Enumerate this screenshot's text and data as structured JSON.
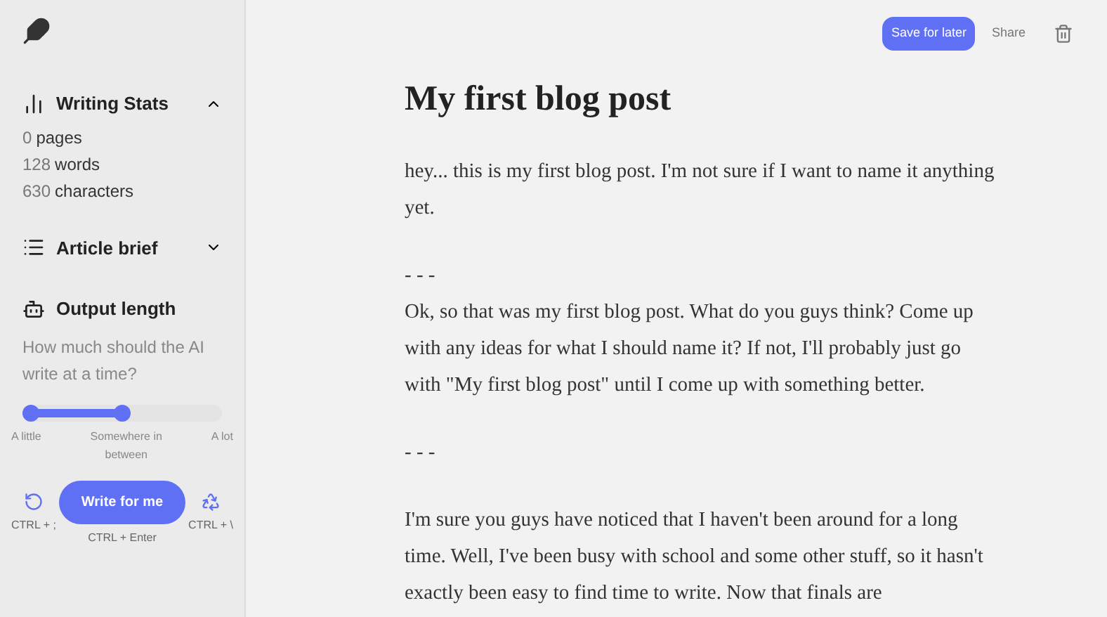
{
  "sidebar": {
    "sections": [
      {
        "kind": "stats",
        "title": "Writing Stats",
        "expanded": true,
        "stats": [
          {
            "count": "0",
            "unit": "pages"
          },
          {
            "count": "128",
            "unit": "words"
          },
          {
            "count": "630",
            "unit": "characters"
          }
        ]
      },
      {
        "kind": "brief",
        "title": "Article brief",
        "expanded": false
      }
    ],
    "output_length": {
      "title": "Output length",
      "question": "How much should the AI write at a time?",
      "level": 0.5,
      "labels": [
        "A little",
        "Somewhere in between",
        "A lot"
      ]
    },
    "actions": {
      "undo_shortcut": "CTRL + ;",
      "write_button": "Write for me",
      "write_shortcut": "CTRL + Enter",
      "redo_shortcut": "CTRL + \\"
    }
  },
  "toolbar": {
    "save": "Save for later",
    "share": "Share"
  },
  "document": {
    "title": "My first blog post",
    "paragraphs": [
      "hey... this is my first blog post. I'm not sure if I want to name it anything yet.",
      "- - -\nOk, so that was my first blog post. What do you guys think? Come up with any ideas for what I should name it? If not, I'll probably just go with \"My first blog post\" until I come up with something better.",
      "- - -",
      "I'm sure you guys have noticed that I haven't been around for a long time. Well, I've been busy with school and some other stuff, so it hasn't exactly been easy to find time to write. Now that finals are"
    ]
  }
}
